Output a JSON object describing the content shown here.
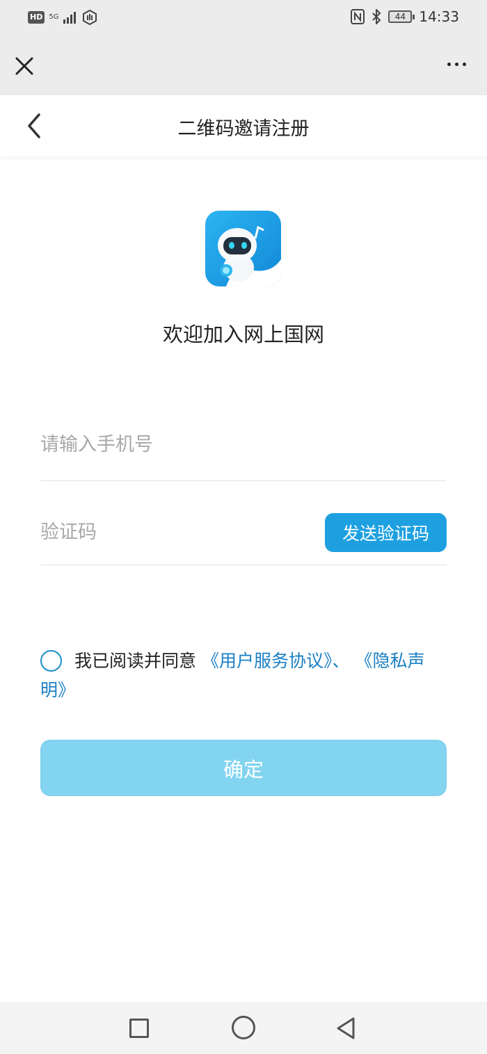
{
  "status_bar": {
    "hd_badge": "HD",
    "network": "5G",
    "battery": "44",
    "time": "14:33"
  },
  "top_bar": {
    "close_icon": "close-icon",
    "more_icon": "more-icon"
  },
  "nav": {
    "title": "二维码邀请注册",
    "back_icon": "back-icon"
  },
  "welcome": {
    "text": "欢迎加入网上国网"
  },
  "form": {
    "phone_placeholder": "请输入手机号",
    "code_placeholder": "验证码",
    "send_code_label": "发送验证码"
  },
  "agreement": {
    "prefix": "我已阅读并同意",
    "user_agreement": "《用户服务协议》",
    "separator": "、",
    "privacy": "《隐私声明》"
  },
  "confirm_label": "确定",
  "colors": {
    "accent": "#1ea0e0",
    "link": "#1a7fc4",
    "confirm_disabled": "#82d4f0",
    "header_bg": "#ececec"
  }
}
